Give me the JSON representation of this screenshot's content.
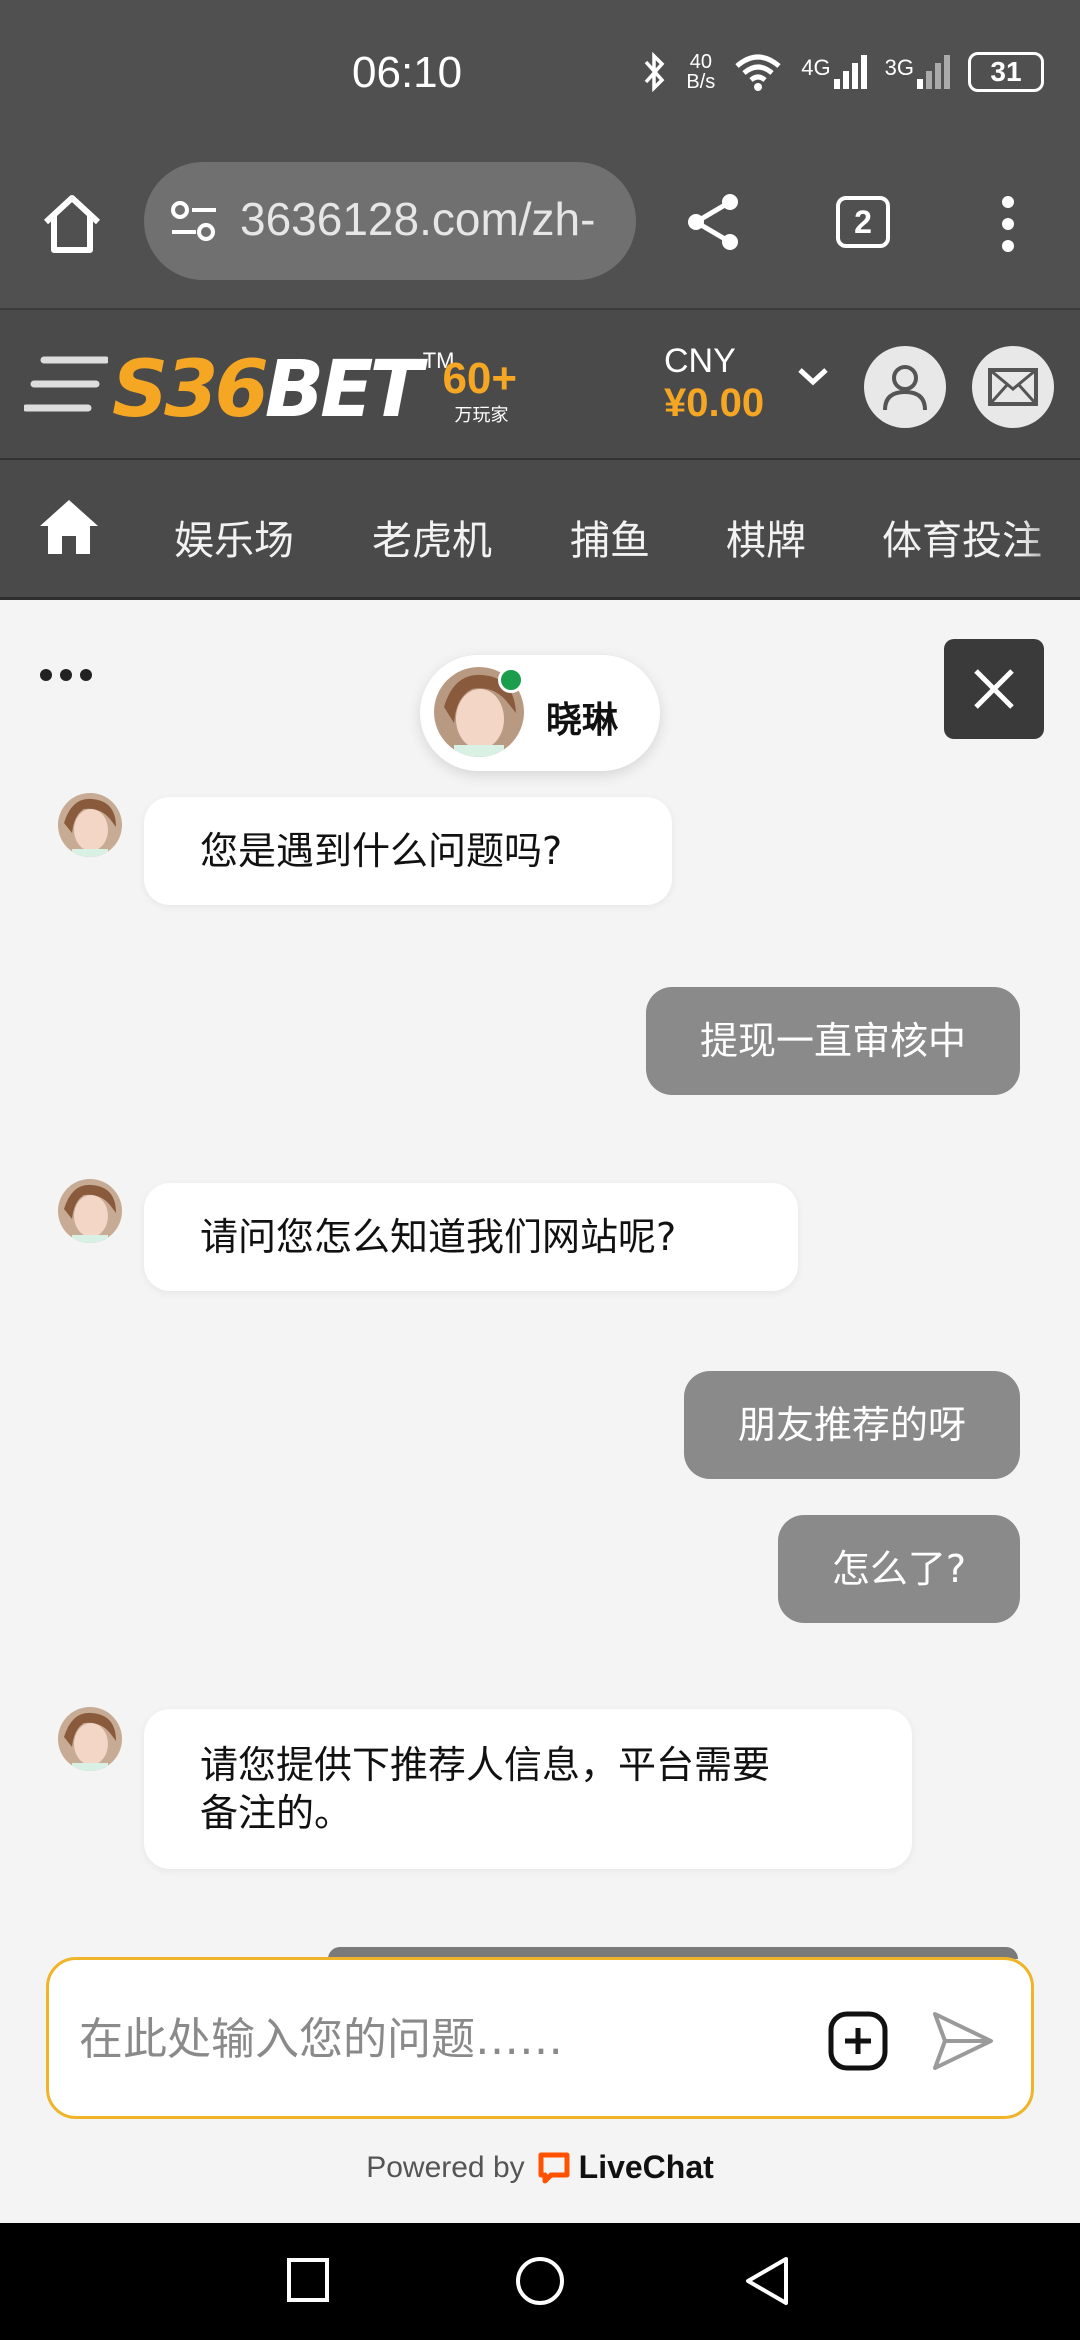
{
  "status_bar": {
    "time": "06:10",
    "net_speed_value": "40",
    "net_speed_unit": "B/s",
    "signal_1": "4G",
    "signal_2": "3G",
    "battery": "31",
    "icons": [
      "bluetooth-icon",
      "wifi-icon",
      "signal-icon",
      "battery-icon"
    ]
  },
  "browser": {
    "url": "3636128.com/zh-",
    "tab_count": "2"
  },
  "site": {
    "logo_main": "S36",
    "logo_bet": "BET",
    "logo_tm": "TM",
    "logo_sixty": "60+",
    "logo_players": "万玩家",
    "currency_code": "CNY",
    "balance": "¥0.00"
  },
  "nav": {
    "items": [
      "娱乐场",
      "老虎机",
      "捕鱼",
      "棋牌",
      "体育投注"
    ]
  },
  "chat": {
    "agent_name": "晓琳",
    "messages": [
      {
        "from": "agent",
        "text": "您是遇到什么问题吗?"
      },
      {
        "from": "user",
        "text": "提现一直审核中"
      },
      {
        "from": "agent",
        "text": "请问您怎么知道我们网站呢?"
      },
      {
        "from": "user",
        "text": "朋友推荐的呀"
      },
      {
        "from": "user",
        "text": "怎么了?"
      },
      {
        "from": "agent",
        "text_line1": "请您提供下推荐人信息，平台需要",
        "text_line2": "备注的。"
      }
    ],
    "input_placeholder": "在此处输入您的问题……",
    "powered_by": "Powered by",
    "brand": "LiveChat"
  },
  "colors": {
    "accent": "#f5a623",
    "header_bg": "#4a4a4a",
    "user_bubble": "#8a8a8a",
    "online": "#1a9e4c",
    "livechat": "#ff5100"
  }
}
